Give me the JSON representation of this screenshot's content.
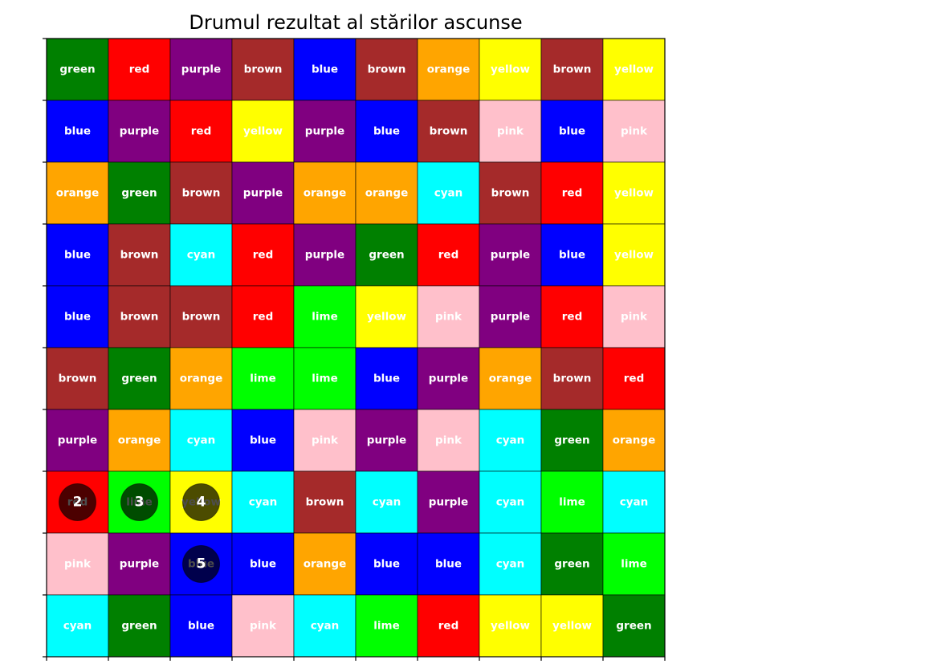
{
  "chart_data": {
    "type": "heatmap",
    "title": "Drumul rezultat al stărilor ascunse",
    "rows": 10,
    "cols": 10,
    "grid": [
      [
        "green",
        "red",
        "purple",
        "brown",
        "blue",
        "brown",
        "orange",
        "yellow",
        "brown",
        "yellow"
      ],
      [
        "blue",
        "purple",
        "red",
        "yellow",
        "purple",
        "blue",
        "brown",
        "pink",
        "blue",
        "pink"
      ],
      [
        "orange",
        "green",
        "brown",
        "purple",
        "orange",
        "orange",
        "cyan",
        "brown",
        "red",
        "yellow"
      ],
      [
        "blue",
        "brown",
        "cyan",
        "red",
        "purple",
        "green",
        "red",
        "purple",
        "blue",
        "yellow"
      ],
      [
        "blue",
        "brown",
        "brown",
        "red",
        "lime",
        "yellow",
        "pink",
        "purple",
        "red",
        "pink"
      ],
      [
        "brown",
        "green",
        "orange",
        "lime",
        "lime",
        "blue",
        "purple",
        "orange",
        "brown",
        "red"
      ],
      [
        "purple",
        "orange",
        "cyan",
        "blue",
        "pink",
        "purple",
        "pink",
        "cyan",
        "green",
        "orange"
      ],
      [
        "red",
        "lime",
        "yellow",
        "cyan",
        "brown",
        "cyan",
        "purple",
        "cyan",
        "lime",
        "cyan"
      ],
      [
        "pink",
        "purple",
        "blue",
        "blue",
        "orange",
        "blue",
        "blue",
        "cyan",
        "green",
        "lime"
      ],
      [
        "cyan",
        "green",
        "blue",
        "pink",
        "cyan",
        "lime",
        "red",
        "yellow",
        "yellow",
        "green"
      ]
    ],
    "path": [
      {
        "step": "2",
        "row": 7,
        "col": 0
      },
      {
        "step": "3",
        "row": 7,
        "col": 1
      },
      {
        "step": "4",
        "row": 7,
        "col": 2
      },
      {
        "step": "5",
        "row": 8,
        "col": 2
      }
    ],
    "colors": {
      "green": "#008000",
      "red": "#ff0000",
      "purple": "#800080",
      "brown": "#a52a2a",
      "blue": "#0000ff",
      "orange": "#ffa500",
      "yellow": "#ffff00",
      "pink": "#ffc0cb",
      "cyan": "#00ffff",
      "lime": "#00ff00"
    },
    "marker_fill": "#000000"
  }
}
